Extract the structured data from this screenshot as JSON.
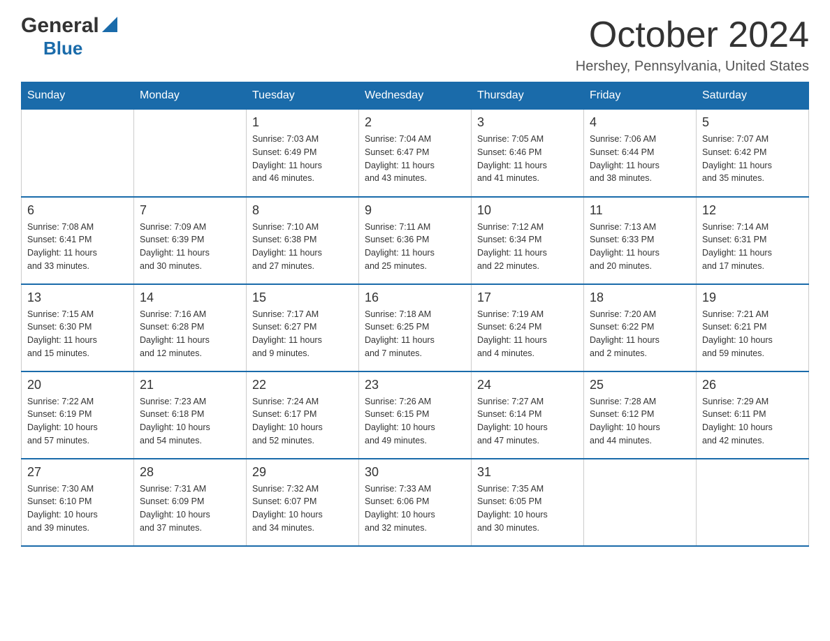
{
  "logo": {
    "general": "General",
    "blue": "Blue"
  },
  "header": {
    "title": "October 2024",
    "location": "Hershey, Pennsylvania, United States"
  },
  "weekdays": [
    "Sunday",
    "Monday",
    "Tuesday",
    "Wednesday",
    "Thursday",
    "Friday",
    "Saturday"
  ],
  "weeks": [
    [
      {
        "day": "",
        "info": ""
      },
      {
        "day": "",
        "info": ""
      },
      {
        "day": "1",
        "info": "Sunrise: 7:03 AM\nSunset: 6:49 PM\nDaylight: 11 hours\nand 46 minutes."
      },
      {
        "day": "2",
        "info": "Sunrise: 7:04 AM\nSunset: 6:47 PM\nDaylight: 11 hours\nand 43 minutes."
      },
      {
        "day": "3",
        "info": "Sunrise: 7:05 AM\nSunset: 6:46 PM\nDaylight: 11 hours\nand 41 minutes."
      },
      {
        "day": "4",
        "info": "Sunrise: 7:06 AM\nSunset: 6:44 PM\nDaylight: 11 hours\nand 38 minutes."
      },
      {
        "day": "5",
        "info": "Sunrise: 7:07 AM\nSunset: 6:42 PM\nDaylight: 11 hours\nand 35 minutes."
      }
    ],
    [
      {
        "day": "6",
        "info": "Sunrise: 7:08 AM\nSunset: 6:41 PM\nDaylight: 11 hours\nand 33 minutes."
      },
      {
        "day": "7",
        "info": "Sunrise: 7:09 AM\nSunset: 6:39 PM\nDaylight: 11 hours\nand 30 minutes."
      },
      {
        "day": "8",
        "info": "Sunrise: 7:10 AM\nSunset: 6:38 PM\nDaylight: 11 hours\nand 27 minutes."
      },
      {
        "day": "9",
        "info": "Sunrise: 7:11 AM\nSunset: 6:36 PM\nDaylight: 11 hours\nand 25 minutes."
      },
      {
        "day": "10",
        "info": "Sunrise: 7:12 AM\nSunset: 6:34 PM\nDaylight: 11 hours\nand 22 minutes."
      },
      {
        "day": "11",
        "info": "Sunrise: 7:13 AM\nSunset: 6:33 PM\nDaylight: 11 hours\nand 20 minutes."
      },
      {
        "day": "12",
        "info": "Sunrise: 7:14 AM\nSunset: 6:31 PM\nDaylight: 11 hours\nand 17 minutes."
      }
    ],
    [
      {
        "day": "13",
        "info": "Sunrise: 7:15 AM\nSunset: 6:30 PM\nDaylight: 11 hours\nand 15 minutes."
      },
      {
        "day": "14",
        "info": "Sunrise: 7:16 AM\nSunset: 6:28 PM\nDaylight: 11 hours\nand 12 minutes."
      },
      {
        "day": "15",
        "info": "Sunrise: 7:17 AM\nSunset: 6:27 PM\nDaylight: 11 hours\nand 9 minutes."
      },
      {
        "day": "16",
        "info": "Sunrise: 7:18 AM\nSunset: 6:25 PM\nDaylight: 11 hours\nand 7 minutes."
      },
      {
        "day": "17",
        "info": "Sunrise: 7:19 AM\nSunset: 6:24 PM\nDaylight: 11 hours\nand 4 minutes."
      },
      {
        "day": "18",
        "info": "Sunrise: 7:20 AM\nSunset: 6:22 PM\nDaylight: 11 hours\nand 2 minutes."
      },
      {
        "day": "19",
        "info": "Sunrise: 7:21 AM\nSunset: 6:21 PM\nDaylight: 10 hours\nand 59 minutes."
      }
    ],
    [
      {
        "day": "20",
        "info": "Sunrise: 7:22 AM\nSunset: 6:19 PM\nDaylight: 10 hours\nand 57 minutes."
      },
      {
        "day": "21",
        "info": "Sunrise: 7:23 AM\nSunset: 6:18 PM\nDaylight: 10 hours\nand 54 minutes."
      },
      {
        "day": "22",
        "info": "Sunrise: 7:24 AM\nSunset: 6:17 PM\nDaylight: 10 hours\nand 52 minutes."
      },
      {
        "day": "23",
        "info": "Sunrise: 7:26 AM\nSunset: 6:15 PM\nDaylight: 10 hours\nand 49 minutes."
      },
      {
        "day": "24",
        "info": "Sunrise: 7:27 AM\nSunset: 6:14 PM\nDaylight: 10 hours\nand 47 minutes."
      },
      {
        "day": "25",
        "info": "Sunrise: 7:28 AM\nSunset: 6:12 PM\nDaylight: 10 hours\nand 44 minutes."
      },
      {
        "day": "26",
        "info": "Sunrise: 7:29 AM\nSunset: 6:11 PM\nDaylight: 10 hours\nand 42 minutes."
      }
    ],
    [
      {
        "day": "27",
        "info": "Sunrise: 7:30 AM\nSunset: 6:10 PM\nDaylight: 10 hours\nand 39 minutes."
      },
      {
        "day": "28",
        "info": "Sunrise: 7:31 AM\nSunset: 6:09 PM\nDaylight: 10 hours\nand 37 minutes."
      },
      {
        "day": "29",
        "info": "Sunrise: 7:32 AM\nSunset: 6:07 PM\nDaylight: 10 hours\nand 34 minutes."
      },
      {
        "day": "30",
        "info": "Sunrise: 7:33 AM\nSunset: 6:06 PM\nDaylight: 10 hours\nand 32 minutes."
      },
      {
        "day": "31",
        "info": "Sunrise: 7:35 AM\nSunset: 6:05 PM\nDaylight: 10 hours\nand 30 minutes."
      },
      {
        "day": "",
        "info": ""
      },
      {
        "day": "",
        "info": ""
      }
    ]
  ]
}
